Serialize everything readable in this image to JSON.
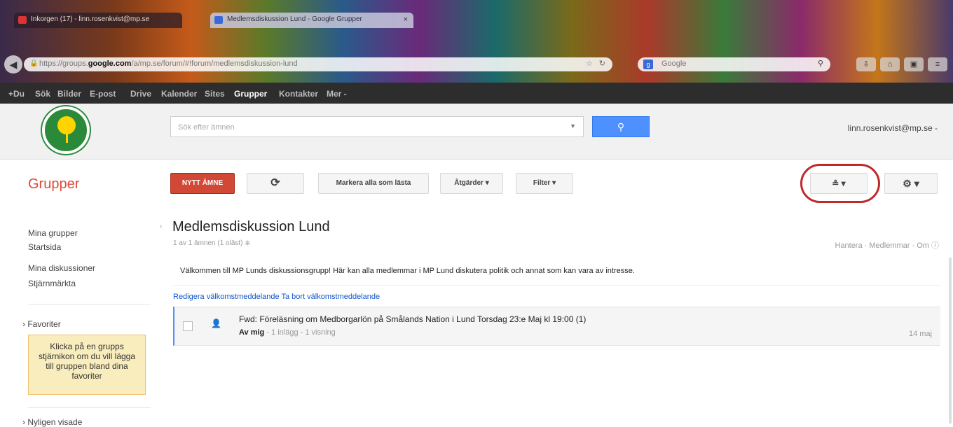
{
  "browser": {
    "tabs": [
      {
        "label": "Inkorgen (17) - linn.rosenkvist@mp.se"
      },
      {
        "label": "Medlemsdiskussion Lund - Google Grupper"
      }
    ],
    "url": {
      "prefix": "https://groups.",
      "domain": "google.com",
      "path": "/a/mp.se/forum/#!forum/medlemsdiskussion-lund"
    },
    "search_engine": "Google"
  },
  "google_bar": [
    "+Du",
    "Sök",
    "Bilder",
    "E-post",
    "Drive",
    "Kalender",
    "Sites",
    "Grupper",
    "Kontakter",
    "Mer -"
  ],
  "header": {
    "search_placeholder": "Sök efter ämnen",
    "account": "linn.rosenkvist@mp.se -"
  },
  "toolbar": {
    "brand": "Grupper",
    "new_topic": "NYTT ÄMNE",
    "refresh_icon": "refresh-icon",
    "mark_read": "Markera alla som lästa",
    "actions": "Åtgärder ▾",
    "filter": "Filter ▾",
    "member_label": "≗ ▾",
    "settings_label": "⚙ ▾",
    "annotation_color": "#c0292a"
  },
  "sidebar": {
    "links": [
      "Mina grupper",
      "Startsida",
      "Mina diskussioner",
      "Stjärnmärkta"
    ],
    "favorites_header": "Favoriter",
    "favorites_hint": "Klicka på en grupps stjärnikon om du vill lägga till gruppen bland dina favoriter",
    "recent_header": "Nyligen visade"
  },
  "forum": {
    "title": "Medlemsdiskussion Lund",
    "subtitle": "1 av 1 ämnen (1 oläst)",
    "right_links": "Hantera · Medlemmar · Om",
    "welcome": "Välkommen till MP Lunds diskussionsgrupp! Här kan alla medlemmar i MP Lund diskutera politik och annat som kan vara av intresse.",
    "edit_links": "Redigera välkomstmeddelande Ta bort välkomstmeddelande",
    "threads": [
      {
        "title": "Fwd: Föreläsning om Medborgarlön på Smålands Nation i Lund Torsdag 23:e Maj kl 19:00",
        "count": "(1)",
        "author": "Av mig",
        "meta": " - 1 inlägg - 1 visning",
        "date": "14 maj"
      }
    ]
  }
}
